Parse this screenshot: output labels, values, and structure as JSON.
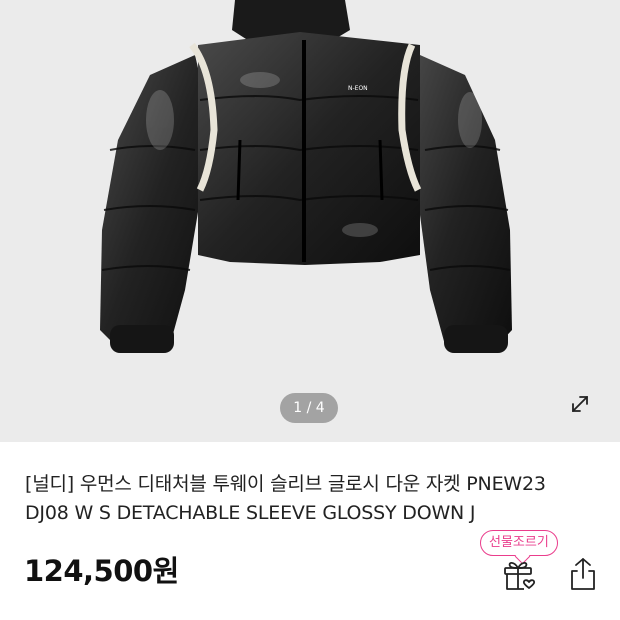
{
  "gallery": {
    "counter": "1 / 4",
    "product_image": "black-glossy-cropped-down-jacket",
    "logo_text": "N-EON",
    "expand_icon": "expand-arrows-icon"
  },
  "product": {
    "title_line1": "[널디] 우먼스 디태처블 투웨이 슬리브 글로시 다운 자켓 PNEW23",
    "title_line2": "DJ08 W S DETACHABLE SLEEVE GLOSSY DOWN J",
    "price": "124,500원"
  },
  "actions": {
    "gift_badge": "선물조르기",
    "gift_icon": "gift-box-heart-icon",
    "share_icon": "share-icon"
  },
  "colors": {
    "accent_pink": "#ea3d8c",
    "gallery_bg": "#ebebeb",
    "pager_bg": "#a3a3a3"
  }
}
